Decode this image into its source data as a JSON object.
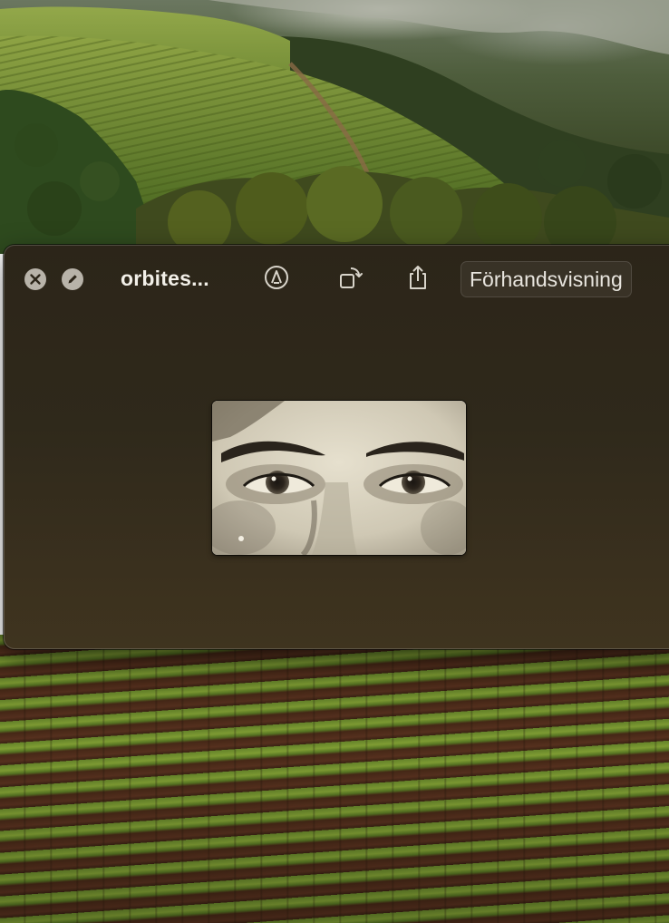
{
  "window": {
    "title": "orbites...",
    "open_with_label": "Förhandsvisning"
  },
  "toolbar": {
    "close_icon": "close-icon",
    "edit_icon": "pencil-icon",
    "markup_icon": "markup-icon",
    "rotate_icon": "rotate-icon",
    "share_icon": "share-icon"
  },
  "preview": {
    "description_icon": "photo-eyes-closeup"
  },
  "colors": {
    "window_bg": "#2f291b",
    "title_text": "#f2efe8",
    "button_gray": "#b8b3a9"
  }
}
